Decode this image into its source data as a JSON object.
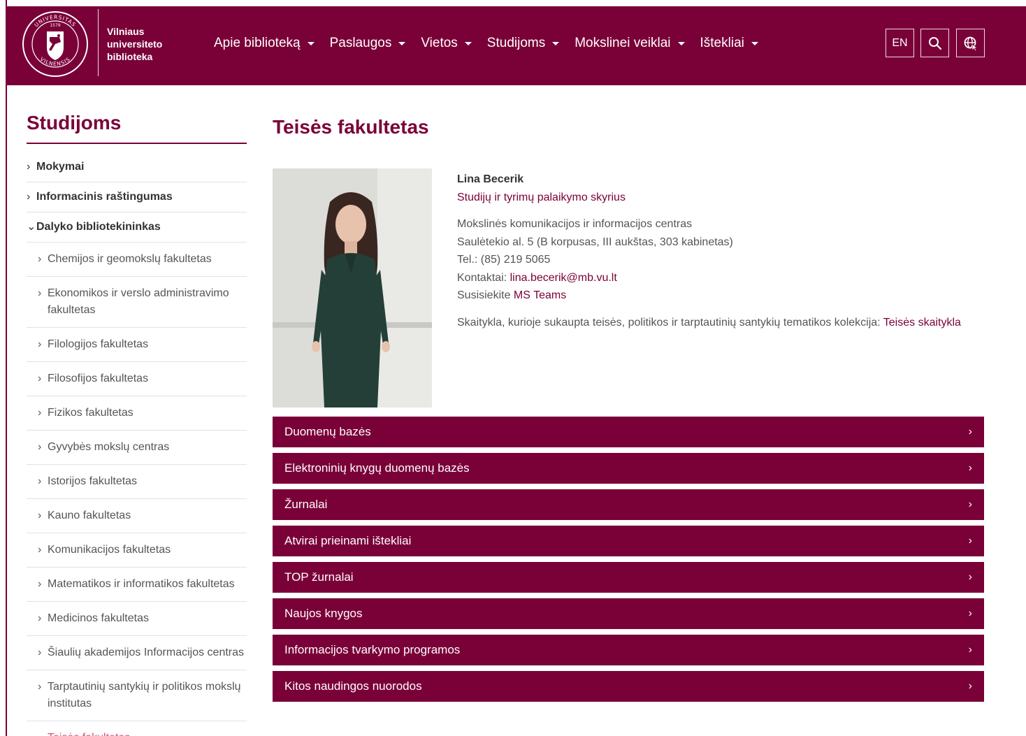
{
  "brand": {
    "logo_lines": [
      "Vilniaus",
      "universiteto",
      "biblioteka"
    ],
    "seal_text_top": "UNIVERSITAS",
    "seal_text_bottom": "VILNENSIS",
    "seal_year": "1579"
  },
  "colors": {
    "primary": "#7a0038",
    "active_link": "#e0506f"
  },
  "nav": {
    "items": [
      {
        "label": "Apie biblioteką"
      },
      {
        "label": "Paslaugos"
      },
      {
        "label": "Vietos"
      },
      {
        "label": "Studijoms"
      },
      {
        "label": "Mokslinei veiklai"
      },
      {
        "label": "Ištekliai"
      }
    ],
    "lang_label": "EN",
    "search_icon": "search-icon",
    "globe_icon": "globe-icon"
  },
  "sidebar": {
    "title": "Studijoms",
    "items": [
      {
        "label": "Mokymai",
        "level": 1,
        "chevron": "›"
      },
      {
        "label": "Informacinis raštingumas",
        "level": 1,
        "chevron": "›"
      },
      {
        "label": "Dalyko bibliotekininkas",
        "level": 1,
        "chevron": "⌄"
      },
      {
        "label": "Chemijos ir geomokslų fakultetas",
        "level": 2,
        "chevron": "›"
      },
      {
        "label": "Ekonomikos ir verslo administravimo fakultetas",
        "level": 2,
        "chevron": "›"
      },
      {
        "label": "Filologijos fakultetas",
        "level": 2,
        "chevron": "›"
      },
      {
        "label": "Filosofijos fakultetas",
        "level": 2,
        "chevron": "›"
      },
      {
        "label": "Fizikos fakultetas",
        "level": 2,
        "chevron": "›"
      },
      {
        "label": "Gyvybės mokslų centras",
        "level": 2,
        "chevron": "›"
      },
      {
        "label": "Istorijos fakultetas",
        "level": 2,
        "chevron": "›"
      },
      {
        "label": "Kauno fakultetas",
        "level": 2,
        "chevron": "›"
      },
      {
        "label": "Komunikacijos fakultetas",
        "level": 2,
        "chevron": "›"
      },
      {
        "label": "Matematikos ir informatikos fakultetas",
        "level": 2,
        "chevron": "›"
      },
      {
        "label": "Medicinos fakultetas",
        "level": 2,
        "chevron": "›"
      },
      {
        "label": "Šiaulių akademijos Informacijos centras",
        "level": 2,
        "chevron": "›"
      },
      {
        "label": "Tarptautinių santykių ir politikos mokslų institutas",
        "level": 2,
        "chevron": "›"
      },
      {
        "label": "Teisės fakultetas",
        "level": 2,
        "chevron": "›",
        "active": true
      }
    ]
  },
  "main": {
    "title": "Teisės fakultetas",
    "contact": {
      "name": "Lina Becerik",
      "department": "Studijų ir tyrimų palaikymo skyrius",
      "center": "Mokslinės komunikacijos ir informacijos centras",
      "address": "Saulėtekio al. 5 (B korpusas, III aukštas, 303 kabinetas)",
      "phone": "Tel.: (85) 219 5065",
      "contacts_label": "Kontaktai: ",
      "email": "lina.becerik@mb.vu.lt",
      "teams_prefix": "Susisiekite ",
      "teams_link": "MS Teams",
      "reading_room_text": "Skaitykla, kurioje sukaupta  teisės, politikos ir tarptautinių santykių tematikos kolekcija: ",
      "reading_room_link": "Teisės skaitykla"
    },
    "accordion": [
      {
        "label": "Duomenų bazės"
      },
      {
        "label": "Elektroninių knygų duomenų bazės"
      },
      {
        "label": "Žurnalai"
      },
      {
        "label": "Atvirai prieinami ištekliai"
      },
      {
        "label": "TOP žurnalai"
      },
      {
        "label": "Naujos knygos"
      },
      {
        "label": "Informacijos tvarkymo programos"
      },
      {
        "label": "Kitos naudingos nuorodos"
      }
    ]
  }
}
